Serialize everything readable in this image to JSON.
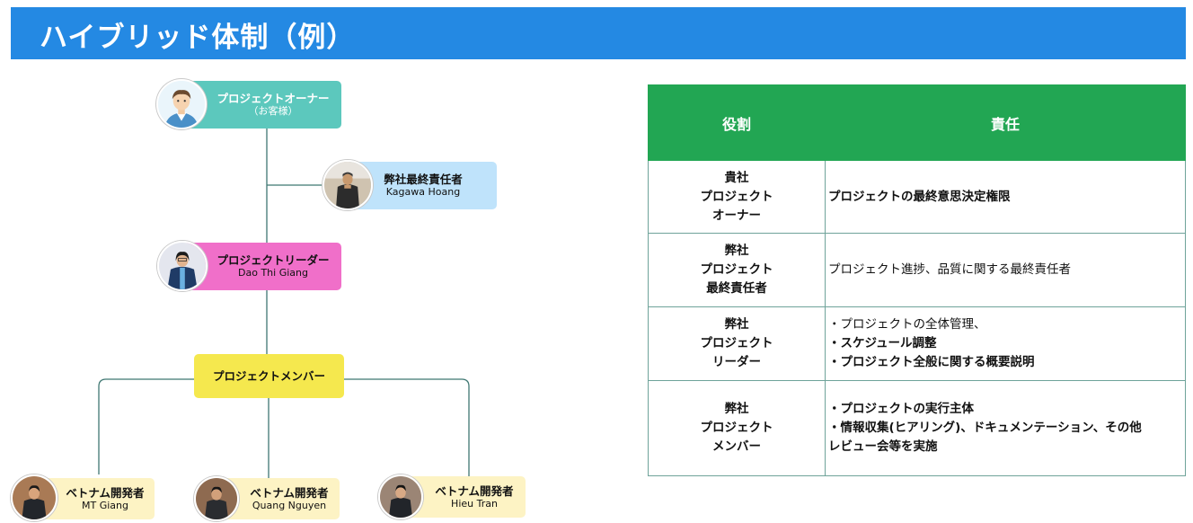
{
  "header": {
    "title": "ハイブリッド体制（例）"
  },
  "org": {
    "owner": {
      "title": "プロジェクトオーナー",
      "subtitle": "（お客様）"
    },
    "executive": {
      "title": "弊社最終責任者",
      "name": "Kagawa Hoang"
    },
    "leader": {
      "title": "プロジェクトリーダー",
      "name": "Dao Thi Giang"
    },
    "members": {
      "title": "プロジェクトメンバー"
    },
    "developers": [
      {
        "title": "ベトナム開発者",
        "name": "MT Giang"
      },
      {
        "title": "ベトナム開発者",
        "name": "Quang Nguyen"
      },
      {
        "title": "ベトナム開発者",
        "name": "Hieu Tran"
      }
    ],
    "colors": {
      "owner": "#5cc8bd",
      "executive": "#bfe3fb",
      "leader": "#f06fc9",
      "members": "#f5e84e",
      "developer": "#fdf3c4",
      "line": "#3f7772"
    }
  },
  "table": {
    "headers": {
      "role": "役割",
      "responsibility": "責任"
    },
    "rows": [
      {
        "role": [
          "貴社",
          "プロジェクト",
          "オーナー"
        ],
        "responsibility": [
          {
            "text": "プロジェクトの最終意思決定権限",
            "bold": true
          }
        ]
      },
      {
        "role": [
          "弊社",
          "プロジェクト",
          "最終責任者"
        ],
        "responsibility": [
          {
            "text": "プロジェクト進捗、品質に関する最終責任者",
            "bold": false
          }
        ]
      },
      {
        "role": [
          "弊社",
          "プロジェクト",
          "リーダー"
        ],
        "responsibility": [
          {
            "text": "・プロジェクトの全体管理、",
            "bold": false
          },
          {
            "text": "・スケジュール調整",
            "bold": true
          },
          {
            "text": "・プロジェクト全般に関する概要説明",
            "bold": true
          }
        ]
      },
      {
        "role": [
          "弊社",
          "プロジェクト",
          "メンバー"
        ],
        "responsibility": [
          {
            "text": "・プロジェクトの実行主体",
            "bold": true
          },
          {
            "text": "・情報収集(ヒアリング)、ドキュメンテーション、その他",
            "bold": true
          },
          {
            "text": "レビュー会等を実施",
            "bold": true
          }
        ]
      }
    ],
    "colors": {
      "header_bg": "#22a653",
      "border": "#6fa39a"
    }
  }
}
